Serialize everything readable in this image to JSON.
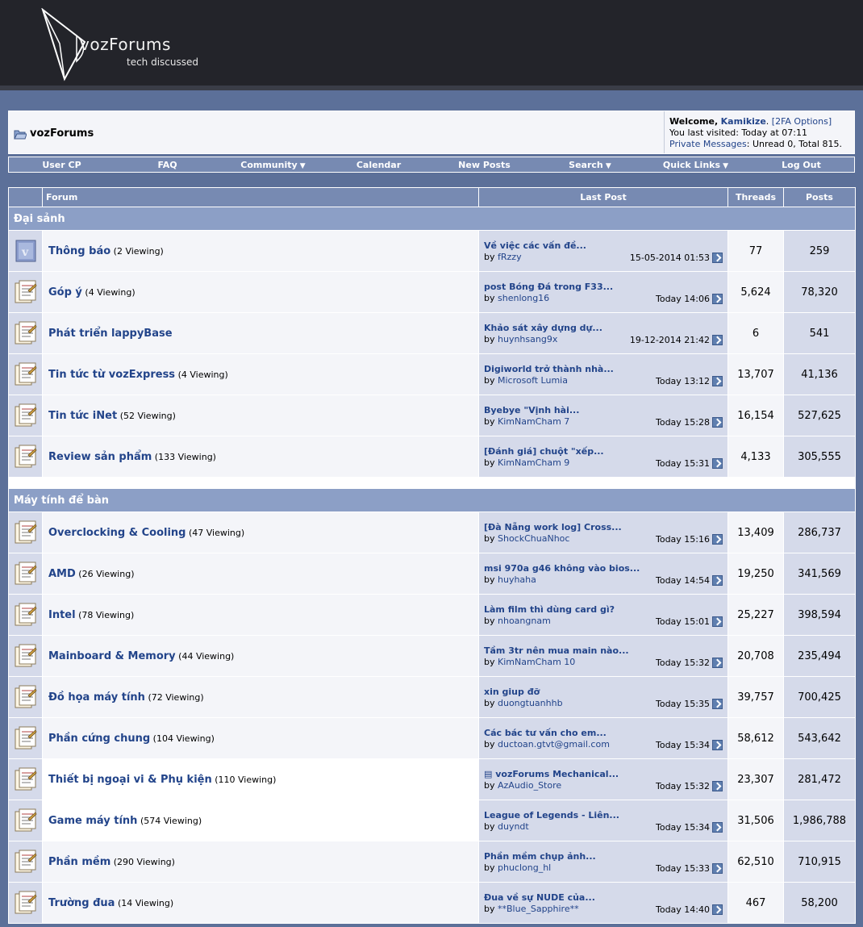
{
  "logo": {
    "word": "vozForums",
    "tagline": "tech discussed"
  },
  "breadcrumb": "vozForums",
  "welcome": {
    "label": "Welcome,",
    "user": "Kamikize",
    "tfa": "[2FA Options]",
    "last_visited": "You last visited: Today at 07:11",
    "pm_link": "Private Messages",
    "pm_info": ": Unread 0, Total 815."
  },
  "menu": [
    {
      "label": "User CP",
      "dropdown": false
    },
    {
      "label": "FAQ",
      "dropdown": false
    },
    {
      "label": "Community",
      "dropdown": true
    },
    {
      "label": "Calendar",
      "dropdown": false
    },
    {
      "label": "New Posts",
      "dropdown": false
    },
    {
      "label": "Search",
      "dropdown": true
    },
    {
      "label": "Quick Links",
      "dropdown": true
    },
    {
      "label": "Log Out",
      "dropdown": false
    }
  ],
  "table_headers": {
    "forum": "Forum",
    "last_post": "Last Post",
    "threads": "Threads",
    "posts": "Posts"
  },
  "categories": [
    {
      "name": "Đại sảnh",
      "forums": [
        {
          "name": "Thông báo",
          "viewing": "(2 Viewing)",
          "icon": "vbulletin-icon",
          "last_title": "Về việc các vấn đề...",
          "last_user": "fRzzy",
          "last_time": "15-05-2014 01:53",
          "threads": "77",
          "posts": "259"
        },
        {
          "name": "Góp ý",
          "viewing": "(4 Viewing)",
          "icon": "forum-icon",
          "last_title": "post Bóng Đá trong F33...",
          "last_user": "shenlong16",
          "last_time": "Today 14:06",
          "threads": "5,624",
          "posts": "78,320"
        },
        {
          "name": "Phát triển lappyBase",
          "viewing": "",
          "icon": "forum-icon",
          "last_title": "Khảo sát xây dựng dự...",
          "last_user": "huynhsang9x",
          "last_time": "19-12-2014 21:42",
          "threads": "6",
          "posts": "541"
        },
        {
          "name": "Tin tức từ vozExpress",
          "viewing": "(4 Viewing)",
          "icon": "forum-icon",
          "last_title": "Digiworld trở thành nhà...",
          "last_user": "Microsoft Lumia",
          "last_time": "Today 13:12",
          "threads": "13,707",
          "posts": "41,136"
        },
        {
          "name": "Tin tức iNet",
          "viewing": "(52 Viewing)",
          "icon": "forum-icon",
          "last_title": "Byebye \"Vịnh hài...",
          "last_user": "KimNamCham 7",
          "last_time": "Today 15:28",
          "threads": "16,154",
          "posts": "527,625"
        },
        {
          "name": "Review sản phẩm",
          "viewing": "(133 Viewing)",
          "icon": "forum-icon",
          "last_title": "[Đánh giá] chuột \"xếp...",
          "last_user": "KimNamCham 9",
          "last_time": "Today 15:31",
          "threads": "4,133",
          "posts": "305,555"
        }
      ]
    },
    {
      "name": "Máy tính để bàn",
      "forums": [
        {
          "name": "Overclocking & Cooling",
          "viewing": "(47 Viewing)",
          "icon": "forum-icon",
          "last_title": "[Đà Nẵng work log] Cross...",
          "last_user": "ShockChuaNhoc",
          "last_time": "Today 15:16",
          "threads": "13,409",
          "posts": "286,737"
        },
        {
          "name": "AMD",
          "viewing": "(26 Viewing)",
          "icon": "forum-icon",
          "last_title": "msi 970a g46 không vào bios...",
          "last_user": "huyhaha",
          "last_time": "Today 14:54",
          "threads": "19,250",
          "posts": "341,569"
        },
        {
          "name": "Intel",
          "viewing": "(78 Viewing)",
          "icon": "forum-icon",
          "last_title": "Làm film thì dùng card gì?",
          "last_user": "nhoangnam",
          "last_time": "Today 15:01",
          "threads": "25,227",
          "posts": "398,594"
        },
        {
          "name": "Mainboard & Memory",
          "viewing": "(44 Viewing)",
          "icon": "forum-icon",
          "last_title": "Tầm 3tr nên mua main nào...",
          "last_user": "KimNamCham 10",
          "last_time": "Today 15:32",
          "threads": "20,708",
          "posts": "235,494"
        },
        {
          "name": "Đồ họa máy tính",
          "viewing": "(72 Viewing)",
          "icon": "forum-icon",
          "last_title": "xin giup đỡ",
          "last_user": "duongtuanhhb",
          "last_time": "Today 15:35",
          "threads": "39,757",
          "posts": "700,425"
        },
        {
          "name": "Phần cứng chung",
          "viewing": "(104 Viewing)",
          "icon": "forum-icon",
          "last_title": "Các bác tư vấn cho em...",
          "last_user": "ductoan.gtvt@gmail.com",
          "last_time": "Today 15:34",
          "threads": "58,612",
          "posts": "543,642"
        },
        {
          "name": "Thiết bị ngoại vi & Phụ kiện",
          "viewing": "(110 Viewing)",
          "icon": "forum-icon",
          "last_title": "▤ vozForums Mechanical...",
          "last_user": "AzAudio_Store",
          "last_time": "Today 15:32",
          "threads": "23,307",
          "posts": "281,472",
          "highlight": true
        },
        {
          "name": "Game máy tính",
          "viewing": "(574 Viewing)",
          "icon": "forum-icon",
          "last_title": "League of Legends - Liên...",
          "last_user": "duyndt",
          "last_time": "Today 15:34",
          "threads": "31,506",
          "posts": "1,986,788",
          "highlight": true
        },
        {
          "name": "Phần mềm",
          "viewing": "(290 Viewing)",
          "icon": "forum-icon",
          "last_title": "Phần mềm chụp ảnh...",
          "last_user": "phuclong_hl",
          "last_time": "Today 15:33",
          "threads": "62,510",
          "posts": "710,915"
        },
        {
          "name": "Trường đua",
          "viewing": "(14 Viewing)",
          "icon": "forum-icon",
          "last_title": "Đua về sự NUDE của...",
          "last_user": "**Blue_Sapphire**",
          "last_time": "Today 14:40",
          "threads": "467",
          "posts": "58,200"
        }
      ]
    }
  ],
  "by_label": "by"
}
